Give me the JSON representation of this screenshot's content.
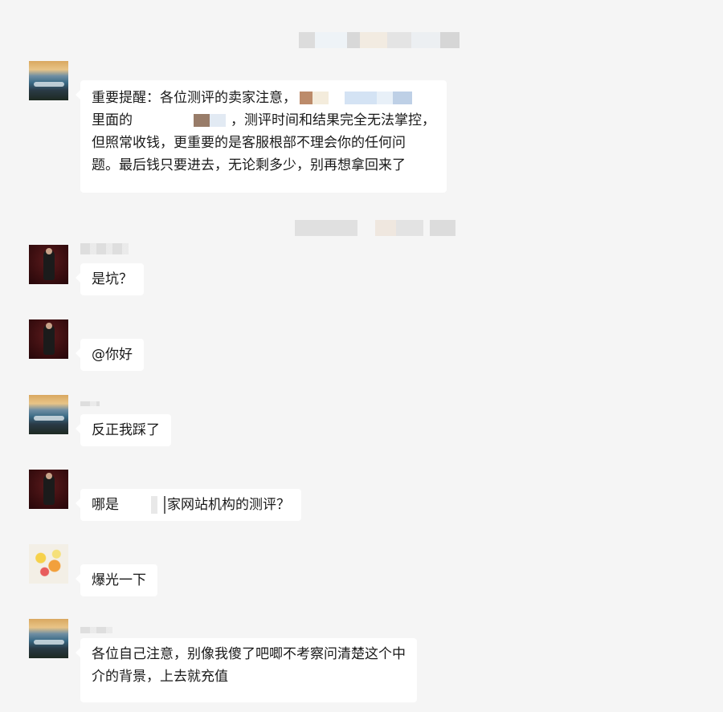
{
  "messages": [
    {
      "avatar": "landscape-avatar",
      "lines": [
        "重要提醒：各位测评的卖家注意，",
        "里面的",
        "，测评时间和结果完全无法掌控，",
        "但照常收钱，更重要的是客服根部不理会你的任何问",
        "题。最后钱只要进去，无论剩多少，别再想拿回来了"
      ]
    },
    {
      "avatar": "person-avatar",
      "text": "是坑？"
    },
    {
      "avatar": "person-avatar",
      "text": "@你好"
    },
    {
      "avatar": "landscape-avatar",
      "text": "反正我踩了"
    },
    {
      "avatar": "person-avatar",
      "text_before": "哪是",
      "text_after": "家网站机构的测评？"
    },
    {
      "avatar": "flowers-avatar",
      "text": "爆光一下"
    },
    {
      "avatar": "landscape-avatar",
      "lines": [
        "各位自己注意，别像我傻了吧唧不考察问清楚这个中",
        "介的背景，上去就充值"
      ]
    }
  ]
}
